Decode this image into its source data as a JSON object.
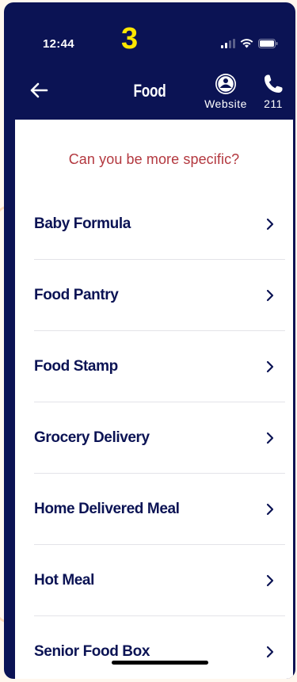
{
  "status_bar": {
    "time": "12:44",
    "step_number": "3"
  },
  "header": {
    "title": "Food",
    "website_label": "Website",
    "call_label": "211"
  },
  "prompt": "Can you be more specific?",
  "items": [
    {
      "label": "Baby Formula"
    },
    {
      "label": "Food Pantry"
    },
    {
      "label": "Food Stamp"
    },
    {
      "label": "Grocery Delivery"
    },
    {
      "label": "Home Delivered Meal"
    },
    {
      "label": "Hot Meal"
    },
    {
      "label": "Senior Food Box"
    }
  ],
  "colors": {
    "brand_navy": "#0b1354",
    "prompt_red": "#b3383f",
    "step_yellow": "#ffe600"
  },
  "icons": {
    "back": "arrow-left-icon",
    "website": "united-way-logo-icon",
    "call": "phone-icon",
    "item": "chevron-right-icon"
  }
}
